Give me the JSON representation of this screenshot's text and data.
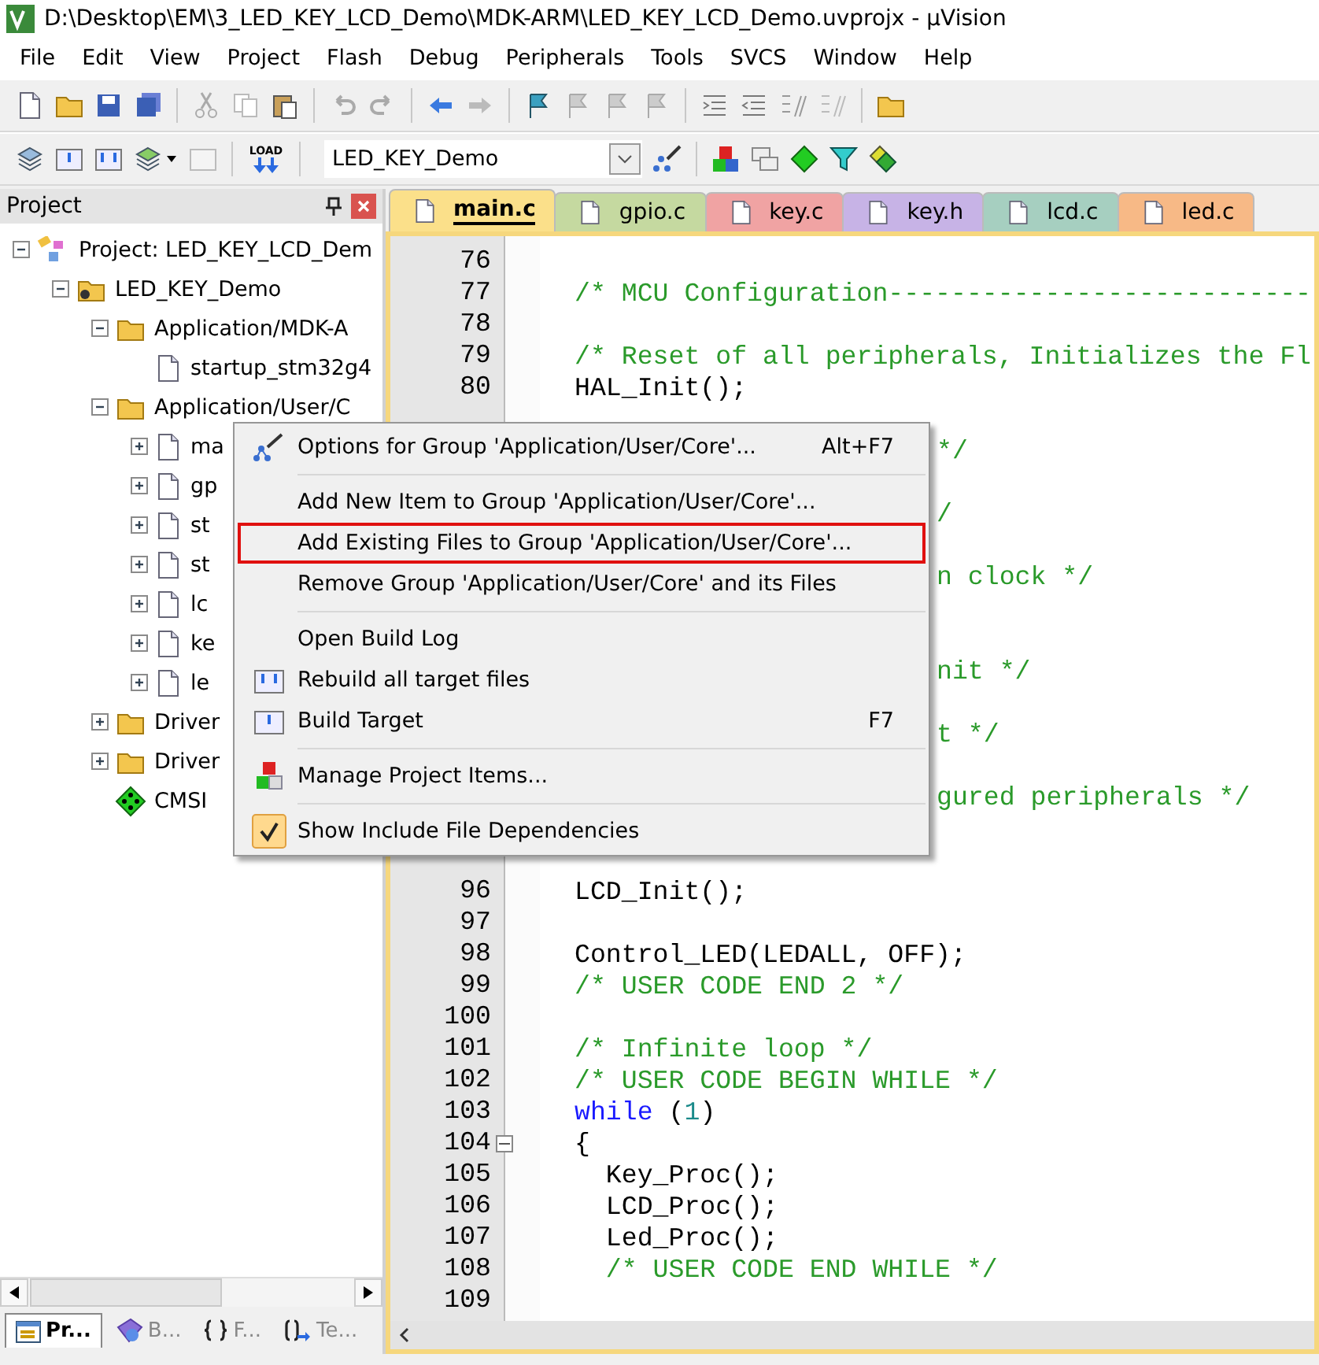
{
  "window": {
    "title": "D:\\Desktop\\EM\\3_LED_KEY_LCD_Demo\\MDK-ARM\\LED_KEY_LCD_Demo.uvprojx - µVision"
  },
  "menu_bar": [
    "File",
    "Edit",
    "View",
    "Project",
    "Flash",
    "Debug",
    "Peripherals",
    "Tools",
    "SVCS",
    "Window",
    "Help"
  ],
  "build_toolbar": {
    "load_label": "LOAD",
    "target": "LED_KEY_Demo"
  },
  "project_panel": {
    "title": "Project",
    "tree": [
      {
        "label": "Project: LED_KEY_LCD_Dem",
        "kind": "project",
        "expanded": true,
        "children": [
          {
            "label": "LED_KEY_Demo",
            "kind": "target",
            "expanded": true,
            "children": [
              {
                "label": "Application/MDK-A",
                "kind": "folder",
                "expanded": true,
                "children": [
                  {
                    "label": "startup_stm32g4",
                    "kind": "file"
                  }
                ]
              },
              {
                "label": "Application/User/C",
                "kind": "folder",
                "expanded": true,
                "children": [
                  {
                    "label": "ma",
                    "kind": "file",
                    "expanded": false
                  },
                  {
                    "label": "gp",
                    "kind": "file",
                    "expanded": false
                  },
                  {
                    "label": "st",
                    "kind": "file",
                    "expanded": false
                  },
                  {
                    "label": "st",
                    "kind": "file",
                    "expanded": false
                  },
                  {
                    "label": "lc",
                    "kind": "file",
                    "expanded": false
                  },
                  {
                    "label": "ke",
                    "kind": "file",
                    "expanded": false
                  },
                  {
                    "label": "le",
                    "kind": "file",
                    "expanded": false
                  }
                ]
              },
              {
                "label": "Driver",
                "kind": "folder",
                "expanded": false
              },
              {
                "label": "Driver",
                "kind": "folder",
                "expanded": false
              },
              {
                "label": "CMSI",
                "kind": "component"
              }
            ]
          }
        ]
      }
    ],
    "bottom_tabs": [
      {
        "label": "Pr...",
        "kind": "project",
        "selected": true
      },
      {
        "label": "B...",
        "kind": "books",
        "selected": false
      },
      {
        "label": "F...",
        "kind": "functions",
        "selected": false
      },
      {
        "label": "Te...",
        "kind": "templates",
        "selected": false
      }
    ]
  },
  "editor": {
    "tabs": [
      {
        "label": "main.c",
        "color": "#fbe08a",
        "selected": true
      },
      {
        "label": "gpio.c",
        "color": "#c5d9a0",
        "selected": false
      },
      {
        "label": "key.c",
        "color": "#f0a3a3",
        "selected": false
      },
      {
        "label": "key.h",
        "color": "#c7b3e6",
        "selected": false
      },
      {
        "label": "lcd.c",
        "color": "#a6cfc0",
        "selected": false
      },
      {
        "label": "led.c",
        "color": "#f7b986",
        "selected": false
      }
    ],
    "lines": [
      {
        "kind": "code",
        "n": "76"
      },
      {
        "kind": "code",
        "n": "77",
        "segs": [
          {
            "t": "/* MCU Configuration---------------------------",
            "kind": "comment"
          }
        ]
      },
      {
        "kind": "code",
        "n": "78"
      },
      {
        "kind": "code",
        "n": "79",
        "segs": [
          {
            "t": "/* Reset of all peripherals, Initializes the Fl",
            "kind": "comment"
          }
        ]
      },
      {
        "kind": "code",
        "n": "80",
        "segs": [
          {
            "t": "HAL_Init();",
            "kind": "plain"
          }
        ]
      },
      {
        "kind": "covered"
      },
      {
        "kind": "covered",
        "fragment": "*/"
      },
      {
        "kind": "covered"
      },
      {
        "kind": "covered",
        "fragment": "/"
      },
      {
        "kind": "covered"
      },
      {
        "kind": "covered",
        "fragment": "n clock */"
      },
      {
        "kind": "covered"
      },
      {
        "kind": "covered"
      },
      {
        "kind": "covered",
        "fragment": "nit */"
      },
      {
        "kind": "covered"
      },
      {
        "kind": "covered",
        "fragment": "t */"
      },
      {
        "kind": "covered"
      },
      {
        "kind": "covered",
        "fragment": "gured peripherals */"
      },
      {
        "kind": "covered"
      },
      {
        "kind": "covered"
      },
      {
        "kind": "code",
        "n": "96",
        "segs": [
          {
            "t": "LCD_Init();",
            "kind": "plain"
          }
        ]
      },
      {
        "kind": "code",
        "n": "97"
      },
      {
        "kind": "code",
        "n": "98",
        "segs": [
          {
            "t": "Control_LED(LEDALL, OFF);",
            "kind": "plain"
          }
        ]
      },
      {
        "kind": "code",
        "n": "99",
        "segs": [
          {
            "t": "/* USER CODE END 2 */",
            "kind": "comment"
          }
        ]
      },
      {
        "kind": "code",
        "n": "100"
      },
      {
        "kind": "code",
        "n": "101",
        "segs": [
          {
            "t": "/* Infinite loop */",
            "kind": "comment"
          }
        ]
      },
      {
        "kind": "code",
        "n": "102",
        "segs": [
          {
            "t": "/* USER CODE BEGIN WHILE */",
            "kind": "comment"
          }
        ]
      },
      {
        "kind": "code",
        "n": "103",
        "segs": [
          {
            "t": "while",
            "kind": "keyword"
          },
          {
            "t": " (",
            "kind": "plain"
          },
          {
            "t": "1",
            "kind": "number"
          },
          {
            "t": ")",
            "kind": "plain"
          }
        ]
      },
      {
        "kind": "code",
        "n": "104",
        "fold": true,
        "segs": [
          {
            "t": "{",
            "kind": "plain"
          }
        ]
      },
      {
        "kind": "code",
        "n": "105",
        "segs": [
          {
            "t": "  Key_Proc();",
            "kind": "plain"
          }
        ]
      },
      {
        "kind": "code",
        "n": "106",
        "segs": [
          {
            "t": "  LCD_Proc();",
            "kind": "plain"
          }
        ]
      },
      {
        "kind": "code",
        "n": "107",
        "segs": [
          {
            "t": "  Led_Proc();",
            "kind": "plain"
          }
        ]
      },
      {
        "kind": "code",
        "n": "108",
        "segs": [
          {
            "t": "  /* USER CODE END WHILE */",
            "kind": "comment"
          }
        ]
      },
      {
        "kind": "code",
        "n": "109"
      }
    ]
  },
  "context_menu": [
    {
      "label": "Options for Group 'Application/User/Core'...",
      "kind": "wand",
      "shortcut": "Alt+F7",
      "separator_after": true
    },
    {
      "label": "Add New  Item to Group 'Application/User/Core'...",
      "kind": "plain"
    },
    {
      "label": "Add Existing Files to Group 'Application/User/Core'...",
      "kind": "plain",
      "annotated": true
    },
    {
      "label": "Remove Group 'Application/User/Core' and its Files",
      "kind": "plain",
      "separator_after": true
    },
    {
      "label": "Open Build Log",
      "kind": "plain"
    },
    {
      "label": "Rebuild all target files",
      "kind": "rebuild"
    },
    {
      "label": "Build Target",
      "kind": "build",
      "shortcut": "F7",
      "separator_after": true
    },
    {
      "label": "Manage Project Items...",
      "kind": "blocks",
      "separator_after": true
    },
    {
      "label": "Show Include File Dependencies",
      "kind": "toggle",
      "checked": true
    }
  ]
}
